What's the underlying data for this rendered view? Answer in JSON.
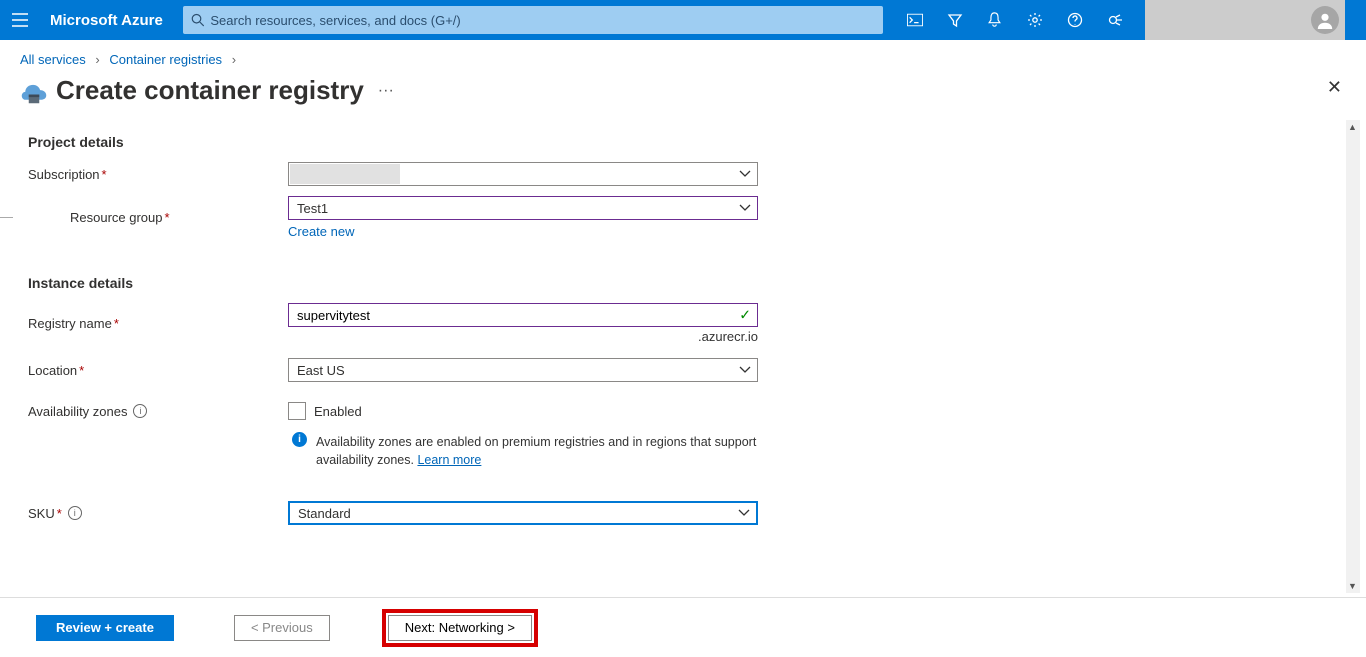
{
  "brand": "Microsoft Azure",
  "search_placeholder": "Search resources, services, and docs (G+/)",
  "breadcrumb": {
    "all_services": "All services",
    "registries": "Container registries"
  },
  "page_title": "Create container registry",
  "sections": {
    "project_details": "Project details",
    "instance_details": "Instance details"
  },
  "labels": {
    "subscription": "Subscription",
    "resource_group": "Resource group",
    "create_new": "Create new",
    "registry_name": "Registry name",
    "location": "Location",
    "availability_zones": "Availability zones",
    "enabled": "Enabled",
    "sku": "SKU",
    "suffix": ".azurecr.io"
  },
  "values": {
    "subscription": "",
    "resource_group": "Test1",
    "registry_name": "supervitytest",
    "location": "East US",
    "sku": "Standard"
  },
  "info_panel": {
    "text_a": "Availability zones are enabled on premium registries and in regions that support availability zones. ",
    "learn_more": "Learn more"
  },
  "buttons": {
    "review_create": "Review + create",
    "previous": "< Previous",
    "next": "Next: Networking >"
  }
}
